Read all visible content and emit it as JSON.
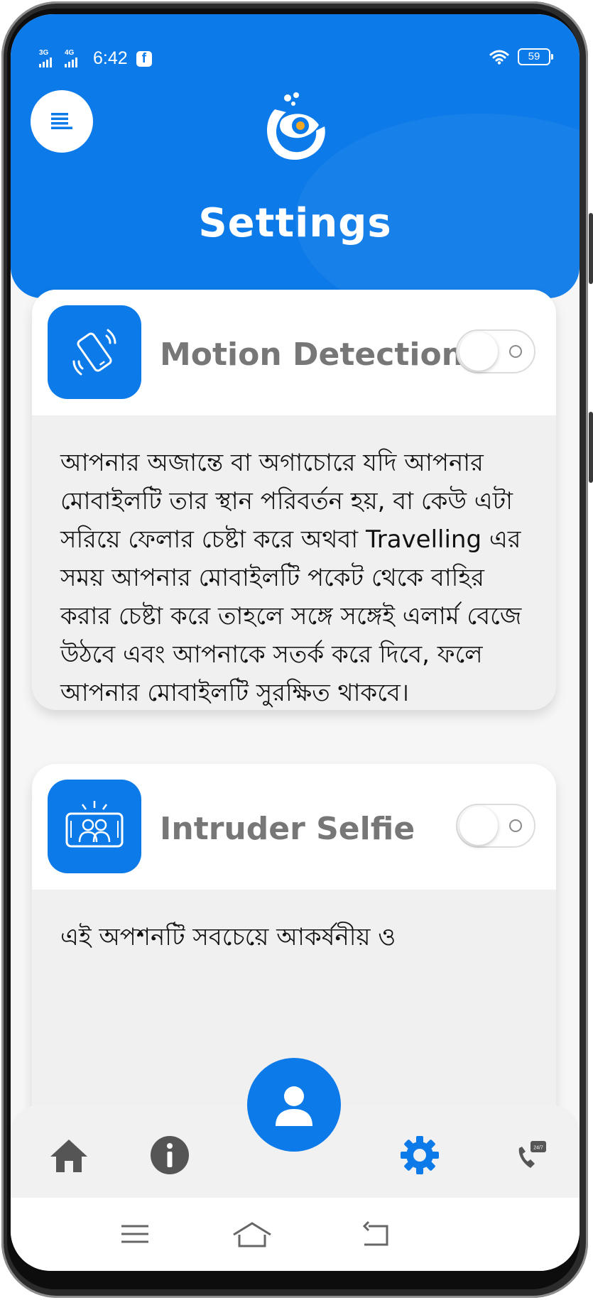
{
  "status_bar": {
    "net1": "3G",
    "net2": "4G",
    "time": "6:42",
    "battery": "59"
  },
  "header": {
    "title": "Settings"
  },
  "cards": [
    {
      "title": "Motion Detection",
      "icon": "phone-vibrate-icon",
      "enabled": false,
      "description": "আপনার অজান্তে বা অগাচোরে যদি আপনার মোবাইলটি তার স্থান পরিবর্তন হয়, বা কেউ এটা সরিয়ে ফেলার চেষ্টা করে অথবা Travelling এর সময় আপনার মোবাইলটি পকেট থেকে বাহির করার চেষ্টা করে তাহলে সঙ্গে সঙ্গেই এলার্ম বেজে উঠবে এবং আপনাকে সতর্ক করে দিবে, ফলে আপনার মোবাইলটি সুরক্ষিত থাকবে।"
    },
    {
      "title": "Intruder Selfie",
      "icon": "selfie-camera-icon",
      "enabled": false,
      "description": "এই অপশনটি সবচেয়ে আকর্ষনীয় ও"
    }
  ],
  "bottom_nav": {
    "items": [
      "home-icon",
      "info-icon",
      "profile-icon",
      "settings-icon",
      "support-24-7-icon"
    ],
    "support_badge": "24/7",
    "active": "settings-icon"
  },
  "colors": {
    "accent": "#0C7AE8",
    "nav_icon": "#555555",
    "card_title": "#777777"
  }
}
